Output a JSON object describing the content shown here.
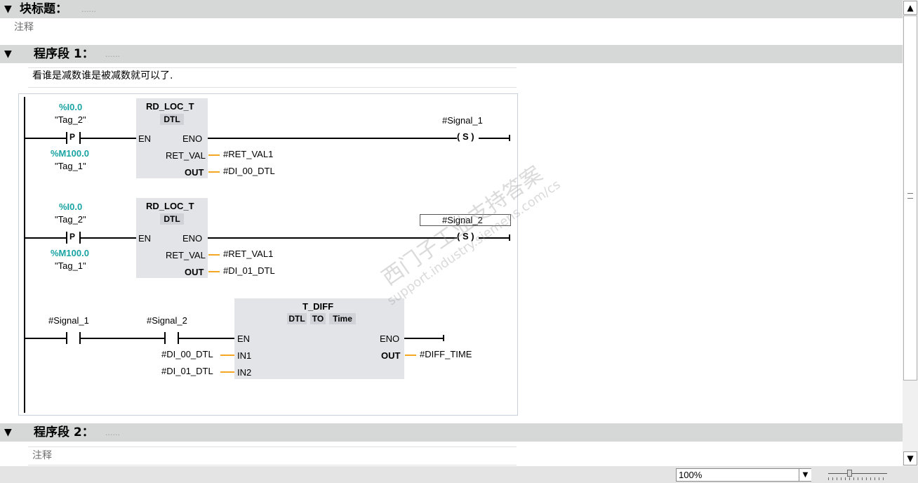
{
  "block_title": {
    "label": "块标题：",
    "dots": "......",
    "comment": "注释"
  },
  "network1": {
    "label": "程序段 1：",
    "dots": "......",
    "comment": "看谁是减数谁是被减数就可以了.",
    "rung1": {
      "contact_p_addr": "%I0.0",
      "contact_p_tag": "\"Tag_2\"",
      "contact_p_symbol": "P",
      "edge_mem_addr": "%M100.0",
      "edge_mem_tag": "\"Tag_1\"",
      "block_name": "RD_LOC_T",
      "block_type": "DTL",
      "pin_en": "EN",
      "pin_eno": "ENO",
      "pin_ret_val": "RET_VAL",
      "pin_out": "OUT",
      "ret_val_var": "#RET_VAL1",
      "out_var": "#DI_00_DTL",
      "coil_tag": "#Signal_1",
      "coil_symbol": "S"
    },
    "rung2": {
      "contact_p_addr": "%I0.0",
      "contact_p_tag": "\"Tag_2\"",
      "contact_p_symbol": "P",
      "edge_mem_addr": "%M100.0",
      "edge_mem_tag": "\"Tag_1\"",
      "block_name": "RD_LOC_T",
      "block_type": "DTL",
      "pin_en": "EN",
      "pin_eno": "ENO",
      "pin_ret_val": "RET_VAL",
      "pin_out": "OUT",
      "ret_val_var": "#RET_VAL1",
      "out_var": "#DI_01_DTL",
      "coil_tag": "#Signal_2",
      "coil_symbol": "S"
    },
    "rung3": {
      "contact1_tag": "#Signal_1",
      "contact2_tag": "#Signal_2",
      "block_name": "T_DIFF",
      "type_in": "DTL",
      "type_to": "TO",
      "type_out": "Time",
      "pin_en": "EN",
      "pin_eno": "ENO",
      "pin_in1": "IN1",
      "pin_in2": "IN2",
      "pin_out": "OUT",
      "in1_var": "#DI_00_DTL",
      "in2_var": "#DI_01_DTL",
      "out_var": "#DIFF_TIME"
    }
  },
  "network2": {
    "label": "程序段 2：",
    "dots": "......",
    "comment": "注释"
  },
  "watermark": {
    "line1": "西门子工业支持答案",
    "line2": "support.industry.siemens.com/cs"
  },
  "statusbar": {
    "zoom_value": "100%"
  },
  "icons": {
    "collapse": "triangle-down-icon",
    "scroll_up": "arrow-up-icon",
    "scroll_down": "arrow-down-icon",
    "scroll_grip": "grip-icon",
    "dropdown": "chevron-down-icon"
  }
}
